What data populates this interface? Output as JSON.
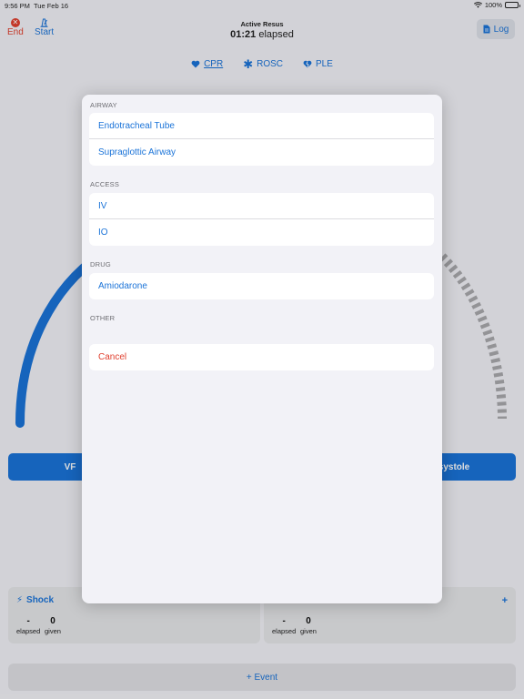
{
  "status": {
    "time": "9:56 PM",
    "date": "Tue Feb 16",
    "battery": "100%"
  },
  "nav": {
    "end_label": "End",
    "start_label": "Start",
    "log_label": "Log"
  },
  "header": {
    "subtitle": "Active Resus",
    "timer": "01:21",
    "timer_suffix": "elapsed"
  },
  "segments": [
    {
      "label": "CPR",
      "icon": "heart-icon",
      "active": true
    },
    {
      "label": "ROSC",
      "icon": "asterisk-icon",
      "active": false
    },
    {
      "label": "PLE",
      "icon": "broken-heart-icon",
      "active": false
    }
  ],
  "rhythm": {
    "left_label": "VF",
    "right_label": "systole"
  },
  "cards": {
    "shock": {
      "title": "Shock",
      "elapsed_value": "-",
      "elapsed_label": "elapsed",
      "given_value": "0",
      "given_label": "given"
    },
    "right": {
      "plus": "+",
      "elapsed_value": "-",
      "elapsed_label": "elapsed",
      "given_value": "0",
      "given_label": "given"
    }
  },
  "event_button": "+ Event",
  "modal": {
    "sections": {
      "airway": {
        "header": "AIRWAY",
        "items": [
          "Endotracheal Tube",
          "Supraglottic Airway"
        ]
      },
      "access": {
        "header": "ACCESS",
        "items": [
          "IV",
          "IO"
        ]
      },
      "drug": {
        "header": "DRUG",
        "items": [
          "Amiodarone"
        ]
      },
      "other": {
        "header": "OTHER"
      }
    },
    "cancel_label": "Cancel"
  },
  "colors": {
    "accent": "#1a73d8",
    "danger": "#e0402f",
    "background": "#f2f2f7"
  }
}
